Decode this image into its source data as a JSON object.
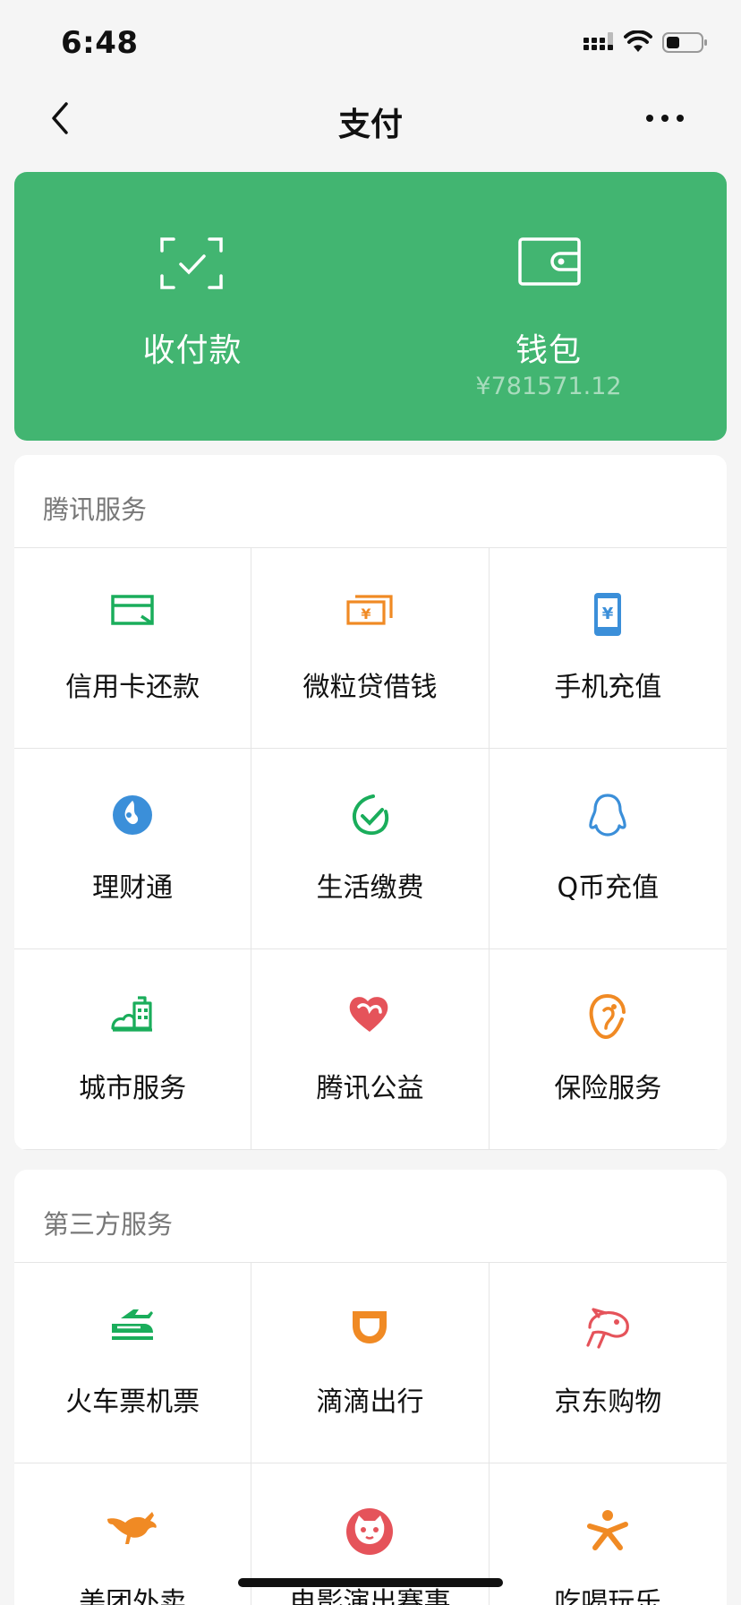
{
  "status_bar": {
    "time": "6:48"
  },
  "nav": {
    "title": "支付"
  },
  "hero": {
    "receive_label": "收付款",
    "wallet_label": "钱包",
    "wallet_balance": "¥781571.12"
  },
  "tencent": {
    "title": "腾讯服务",
    "items": [
      {
        "label": "信用卡还款",
        "icon": "credit-card-icon",
        "color": "#1aad5b"
      },
      {
        "label": "微粒贷借钱",
        "icon": "loan-money-icon",
        "color": "#f08a24"
      },
      {
        "label": "手机充值",
        "icon": "mobile-topup-icon",
        "color": "#3b8fd9"
      },
      {
        "label": "理财通",
        "icon": "wealth-icon",
        "color": "#3b8fd9"
      },
      {
        "label": "生活缴费",
        "icon": "utility-bill-icon",
        "color": "#1aad5b"
      },
      {
        "label": "Q币充值",
        "icon": "qq-penguin-icon",
        "color": "#3b8fd9"
      },
      {
        "label": "城市服务",
        "icon": "city-building-icon",
        "color": "#1aad5b"
      },
      {
        "label": "腾讯公益",
        "icon": "charity-heart-icon",
        "color": "#e5535a"
      },
      {
        "label": "保险服务",
        "icon": "insurance-icon",
        "color": "#f08a24"
      }
    ]
  },
  "third": {
    "title": "第三方服务",
    "items": [
      {
        "label": "火车票机票",
        "icon": "train-plane-icon",
        "color": "#1aad5b"
      },
      {
        "label": "滴滴出行",
        "icon": "didi-icon",
        "color": "#f08a24"
      },
      {
        "label": "京东购物",
        "icon": "jd-dog-icon",
        "color": "#e5535a"
      },
      {
        "label": "美团外卖",
        "icon": "kangaroo-icon",
        "color": "#f08a24"
      },
      {
        "label": "电影演出赛事",
        "icon": "cat-face-icon",
        "color": "#e5535a"
      },
      {
        "label": "吃喝玩乐",
        "icon": "person-fun-icon",
        "color": "#f08a24"
      }
    ]
  }
}
